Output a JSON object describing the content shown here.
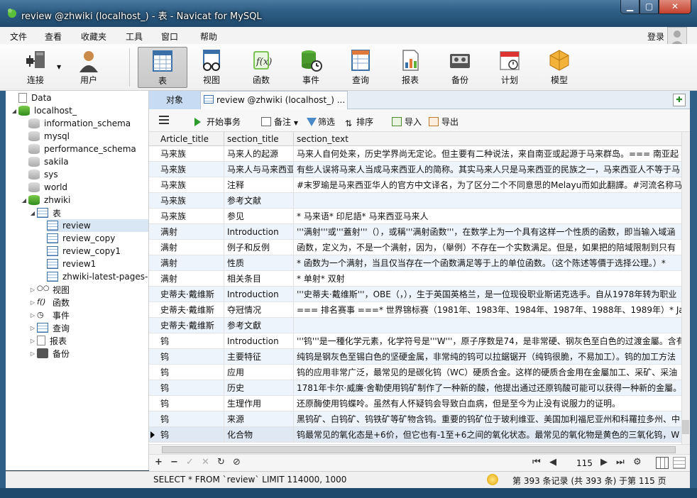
{
  "window": {
    "title": "review @zhwiki (localhost_) - 表 - Navicat for MySQL"
  },
  "menu": {
    "items": [
      "文件",
      "查看",
      "收藏夹",
      "工具",
      "窗口",
      "帮助"
    ],
    "login": "登录"
  },
  "toolbar": {
    "connect": "连接",
    "user": "用户",
    "table": "表",
    "view": "视图",
    "function": "函数",
    "event": "事件",
    "query": "查询",
    "report": "报表",
    "backup": "备份",
    "schedule": "计划",
    "model": "模型"
  },
  "tree": {
    "data": "Data",
    "localhost": "localhost_",
    "dbs": [
      "information_schema",
      "mysql",
      "performance_schema",
      "sakila",
      "sys",
      "world"
    ],
    "zhwiki": "zhwiki",
    "tables": "表",
    "table_items": [
      "review",
      "review_copy",
      "review_copy1",
      "review1",
      "zhwiki-latest-pages-"
    ],
    "views": "视图",
    "functions": "函数",
    "events": "事件",
    "queries": "查询",
    "reports": "报表",
    "backups": "备份"
  },
  "tabs": {
    "objects": "对象",
    "review": "review @zhwiki (localhost_) ..."
  },
  "actions": {
    "begin": "开始事务",
    "note": "备注",
    "filter": "筛选",
    "sort": "排序",
    "import": "导入",
    "export": "导出"
  },
  "grid": {
    "columns": [
      "Article_title",
      "section_title",
      "section_text"
    ],
    "rows": [
      [
        "马来族",
        "马来人的起源",
        "马来人自何处来，历史学界尚无定论。但主要有二种说法，来自南亚或起源于马来群岛。=== 南亚起"
      ],
      [
        "马来族",
        "马来人与马来西亚",
        "有些人误将马来人当成马来西亚人的简称。其实马来人只是马来西亚的民族之一，马来西亚人不等于马"
      ],
      [
        "马来族",
        "注释",
        "#末罗瑜是马来西亚华人的官方中文译名，为了区分二个不同意思的Melayu而如此翻譯。#河流名称马"
      ],
      [
        "马来族",
        "参考文献",
        ""
      ],
      [
        "马来族",
        "参见",
        "* 马来语* 印尼語* 马来西亚马来人"
      ],
      [
        "满射",
        "Introduction",
        "'''满射'''或'''蓋射'''（），或稱'''满射函数'''，在数学上为一个具有这样一个性质的函数，即当输入域涵"
      ],
      [
        "满射",
        "例子和反例",
        "函数，定义为，不是一个满射，因为，（舉例）不存在一个实数满足。但是，如果把的陪域限制到只有"
      ],
      [
        "满射",
        "性质",
        "* 函数为一个满射，当且仅当存在一个函数满足等于上的单位函数。（这个陈述等價于选择公理。）* "
      ],
      [
        "满射",
        "相关条目",
        "* 单射* 双射"
      ],
      [
        "史蒂夫·戴维斯",
        "Introduction",
        "'''史蒂夫·戴维斯'''，OBE（，），生于英国英格兰，是一位现役职业斯诺克选手。自从1978年转为职业"
      ],
      [
        "史蒂夫·戴维斯",
        "夺冠情况",
        "=== 排名赛事 ===* 世界锦标赛（1981年、1983年、1984年、1987年、1988年、1989年）* Jam"
      ],
      [
        "史蒂夫·戴维斯",
        "参考文獻",
        ""
      ],
      [
        "钨",
        "Introduction",
        "'''钨'''是一種化学元素，化学符号是'''W'''，原子序数是74，是非常硬、钢灰色至白色的过渡金屬。含有"
      ],
      [
        "钨",
        "主要特征",
        "纯钨是钢灰色至锡白色的坚硬金属，非常纯的钨可以拉鋸锯开（纯钨很脆，不易加工）。钨的加工方法"
      ],
      [
        "钨",
        "应用",
        "钨的应用非常广泛，最常见的是碳化钨（WC）硬质合金。这样的硬质合金用在金屬加工、采矿、采油"
      ],
      [
        "钨",
        "历史",
        "1781年卡尔·威廉·舍勒使用钨矿制作了一种新的酸，他提出通过还原钨酸可能可以获得一种新的金屬。"
      ],
      [
        "钨",
        "生理作用",
        "还原酶使用钨蝶呤。虽然有人怀疑钨会导致白血病，但是至今为止没有说服力的证明。"
      ],
      [
        "钨",
        "来源",
        "黑钨矿、白钨矿、钨铁矿等矿物含钨。重要的钨矿位于玻利维亚、美国加利福尼亚州和科羅拉多州、中"
      ],
      [
        "钨",
        "化合物",
        "钨最常见的氧化态是+6价，但它也有-1至+6之间的氧化状态。最常见的氧化物是黄色的三氧化钨，W"
      ]
    ]
  },
  "navbar": {
    "page": "115"
  },
  "status": {
    "sql": "SELECT * FROM `review` LIMIT 114000, 1000",
    "records": "第 393 条记录 (共 393 条) 于第 115 页"
  }
}
